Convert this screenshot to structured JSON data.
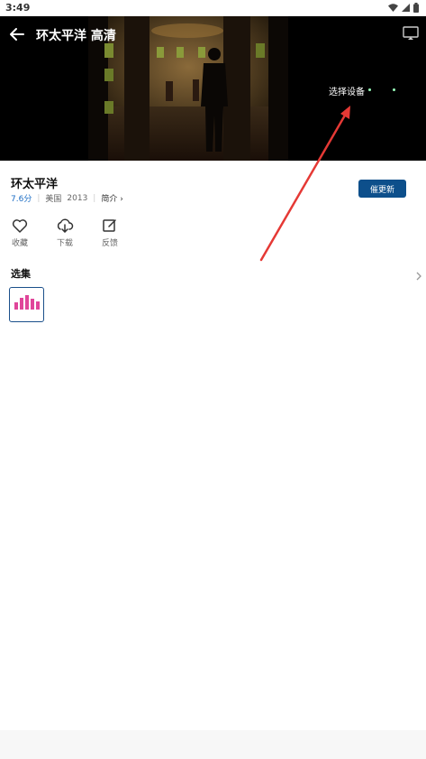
{
  "status_bar": {
    "time": "3:49"
  },
  "player": {
    "title": "环太平洋 高清",
    "device_prompt": "选择设备"
  },
  "movie": {
    "title": "环太平洋",
    "score": "7.6分",
    "region": "美国",
    "year": "2013",
    "intro_label": "简介 ›",
    "urge_update_label": "催更新"
  },
  "actions": [
    {
      "label": "收藏",
      "icon": "heart-icon"
    },
    {
      "label": "下载",
      "icon": "cloud-download-icon"
    },
    {
      "label": "反馈",
      "icon": "edit-icon"
    }
  ],
  "episodes": {
    "header": "选集",
    "playing_icon": "sound-bars-icon",
    "accent_color": "#e0459a"
  },
  "colors": {
    "primary": "#0d4f8b",
    "score": "#1a6cc4",
    "annotation_arrow": "#e53935"
  }
}
